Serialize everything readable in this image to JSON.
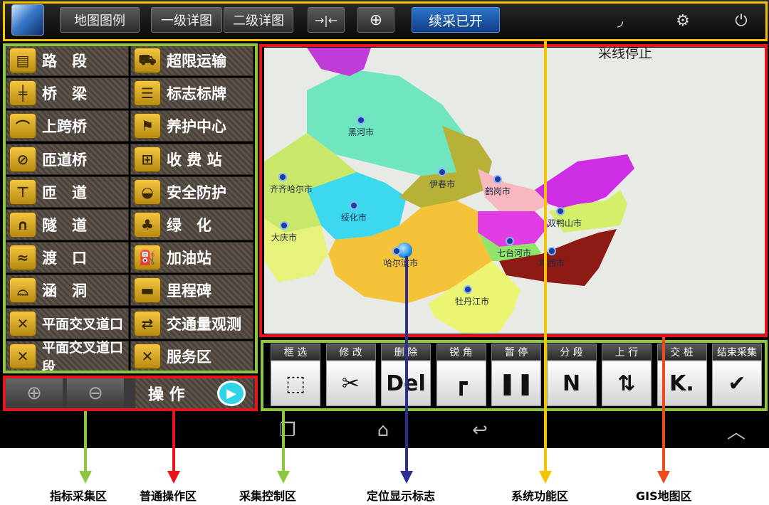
{
  "topbar": {
    "legend_label": "地图图例",
    "detail1_label": "一级详图",
    "detail2_label": "二级详图",
    "continue_label": "续采已开"
  },
  "indicators": {
    "left_col": [
      "路　段",
      "桥　梁",
      "上跨桥",
      "匝道桥",
      "匝　道",
      "隧　道",
      "渡　口",
      "涵　洞",
      "平面交叉道口",
      "平面交叉道口段"
    ],
    "right_col": [
      "超限运输",
      "标志标牌",
      "养护中心",
      "收 费 站",
      "安全防护",
      "绿　化",
      "加油站",
      "里程碑",
      "交通量观测",
      "服务区"
    ]
  },
  "map": {
    "status_text": "采线停止",
    "cities": [
      "黑河市",
      "齐齐哈尔市",
      "伊春市",
      "鹤岗市",
      "绥化市",
      "双鸭山市",
      "大庆市",
      "七台河市",
      "哈尔滨市",
      "鸡西市",
      "牡丹江市"
    ]
  },
  "controls": [
    "框 选",
    "修 改",
    "删 除",
    "锐 角",
    "暂 停",
    "分 段",
    "上 行",
    "交 桩",
    "结束采集"
  ],
  "control_icons": [
    "⬚",
    "✂",
    "Del",
    "┏",
    "❚❚",
    "N",
    "⇅",
    "K.",
    "✔"
  ],
  "ops": {
    "operate_label": "操 作"
  },
  "annotations": [
    "指标采集区",
    "普通操作区",
    "采集控制区",
    "定位显示标志",
    "系统功能区",
    "GIS地图区"
  ],
  "colors": {
    "yellow": "#f5c400",
    "green": "#8dc63f",
    "red": "#e8141c",
    "navy": "#2b2f8f",
    "orange": "#f04a1a"
  }
}
